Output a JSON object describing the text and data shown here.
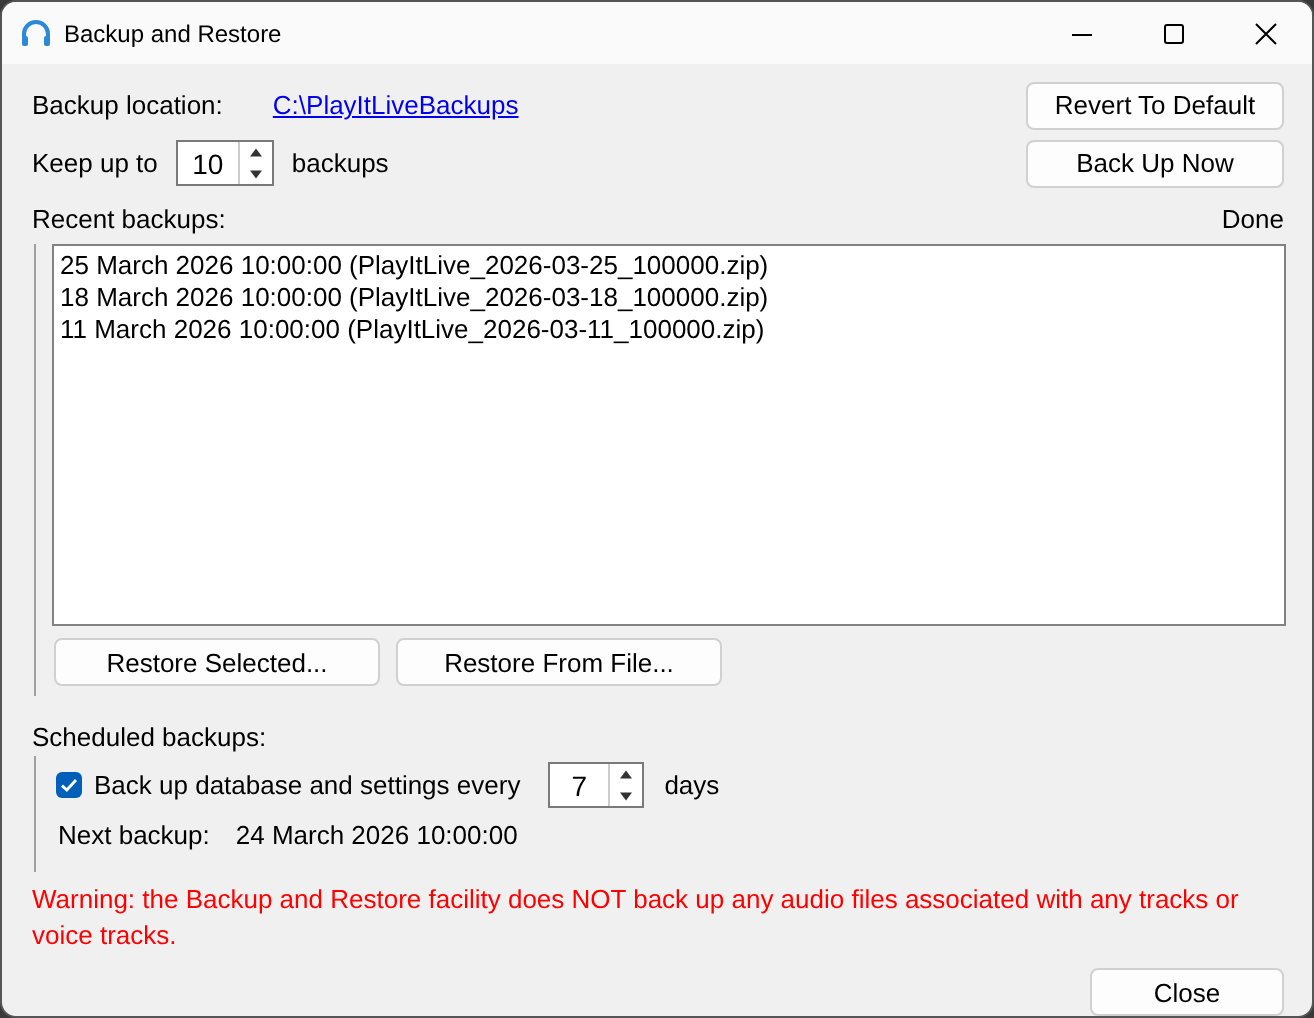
{
  "window": {
    "title": "Backup and Restore"
  },
  "backup_location": {
    "label": "Backup location:",
    "path": "C:\\PlayItLiveBackups"
  },
  "keep": {
    "label": "Keep up to",
    "value": "10",
    "unit": "backups"
  },
  "top_buttons": [
    "Revert To Default",
    "Back Up Now"
  ],
  "recent": {
    "label": "Recent backups:",
    "status": "Done",
    "items": [
      {
        "text": "25 March 2026 10:00:00 (PlayItLive_2026-03-25_100000.zip)",
        "selected": false
      },
      {
        "text": "18 March 2026 10:00:00 (PlayItLive_2026-03-18_100000.zip)",
        "selected": false
      },
      {
        "text": "11 March 2026 10:00:00 (PlayItLive_2026-03-11_100000.zip)",
        "selected": false
      }
    ]
  },
  "restore_buttons": [
    "Restore Selected...",
    "Restore From File..."
  ],
  "scheduled": {
    "label": "Scheduled backups:",
    "checked": true,
    "checkbox_label": "Back up database and settings every",
    "interval": "7",
    "unit": "days",
    "next_label": "Next backup:",
    "next_value": "24 March 2026 10:00:00"
  },
  "warning": "Warning: the Backup and Restore facility does NOT back up any audio files associated with any tracks or voice tracks.",
  "close_button": "Close"
}
